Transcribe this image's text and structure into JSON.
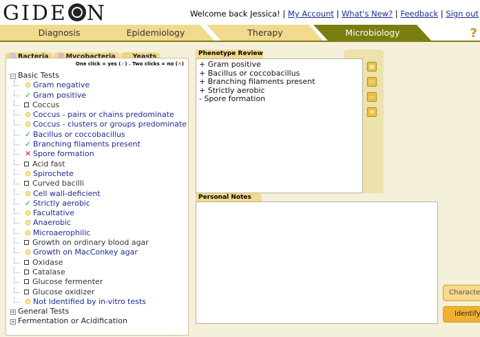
{
  "header": {
    "logo": {
      "before": "GIDE",
      "after": "N"
    },
    "welcome_text": "Welcome back Jessica! |",
    "links": [
      "My Account",
      "What's New?",
      "Feedback",
      "Sign out"
    ]
  },
  "main_tabs": [
    {
      "label": "Diagnosis",
      "active": false
    },
    {
      "label": "Epidemiology",
      "active": false
    },
    {
      "label": "Therapy",
      "active": false
    },
    {
      "label": "Microbiology",
      "active": true
    }
  ],
  "help_icon": "?",
  "left_tabs": [
    "Bacteria",
    "Mycobacteria",
    "Yeasts"
  ],
  "legend": {
    "text_a": "One click = yes (",
    "yes_mark": "✓",
    "text_b": ") . Two clicks = no (",
    "no_mark": "✕",
    "text_c": ")"
  },
  "tree": {
    "groups": [
      {
        "label": "Basic Tests",
        "expanded": true
      },
      {
        "label": "General Tests",
        "expanded": false
      },
      {
        "label": "Fermentation or Acidification",
        "expanded": false
      }
    ],
    "basic_items": [
      {
        "label": "Gram negative",
        "state": "unknown"
      },
      {
        "label": "Gram positive",
        "state": "yes"
      },
      {
        "label": "Coccus",
        "state": "none"
      },
      {
        "label": "Coccus - pairs or chains predominate",
        "state": "unknown"
      },
      {
        "label": "Coccus - clusters or groups predominate",
        "state": "unknown"
      },
      {
        "label": "Bacillus or coccobacillus",
        "state": "yes"
      },
      {
        "label": "Branching filaments present",
        "state": "yes"
      },
      {
        "label": "Spore formation",
        "state": "no"
      },
      {
        "label": "Acid fast",
        "state": "none"
      },
      {
        "label": "Spirochete",
        "state": "unknown"
      },
      {
        "label": "Curved bacilli",
        "state": "none"
      },
      {
        "label": "Cell wall-deficient",
        "state": "unknown"
      },
      {
        "label": "Strictly aerobic",
        "state": "yes"
      },
      {
        "label": "Facultative",
        "state": "unknown"
      },
      {
        "label": "Anaerobic",
        "state": "unknown"
      },
      {
        "label": "Microaerophilic",
        "state": "unknown"
      },
      {
        "label": "Growth on ordinary blood agar",
        "state": "none"
      },
      {
        "label": "Growth on MacConkey agar",
        "state": "unknown"
      },
      {
        "label": "Oxidase",
        "state": "none"
      },
      {
        "label": "Catalase",
        "state": "none"
      },
      {
        "label": "Glucose fermenter",
        "state": "none"
      },
      {
        "label": "Glucose oxidizer",
        "state": "none"
      },
      {
        "label": "Not identified by in-vitro tests",
        "state": "unknown"
      }
    ]
  },
  "phenotype": {
    "tab_label": "Phenotype Review",
    "lines": [
      "+ Gram positive",
      "+ Bacillus or coccobacillus",
      "+ Branching filaments present",
      "+ Strictly aerobic",
      "- Spore formation"
    ]
  },
  "notes": {
    "tab_label": "Personal Notes",
    "value": ""
  },
  "right_buttons": {
    "characterize": "Characterize",
    "identify": "Identify!"
  },
  "colors": {
    "accent": "#7a7d10",
    "tab": "#f1d98e",
    "link": "#1a2a9a",
    "yes": "#22a022",
    "no": "#d81c1c",
    "unknown": "#e5c000"
  }
}
